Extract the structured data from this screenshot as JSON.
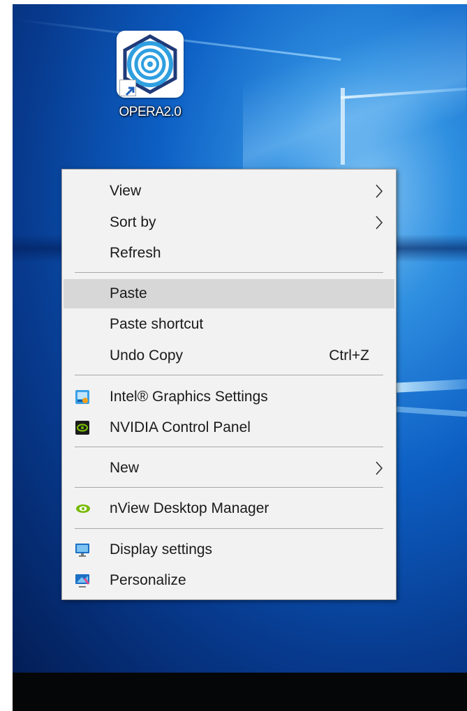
{
  "desktop": {
    "shortcut": {
      "label": "OPERA2.0",
      "icon": "opera-spiral-icon"
    }
  },
  "menu": {
    "items": [
      {
        "label": "View",
        "submenu": true
      },
      {
        "label": "Sort by",
        "submenu": true
      },
      {
        "label": "Refresh"
      },
      {
        "label": "Paste",
        "highlighted": true
      },
      {
        "label": "Paste shortcut"
      },
      {
        "label": "Undo Copy",
        "shortcut": "Ctrl+Z"
      },
      {
        "label": "Intel® Graphics Settings",
        "icon": "intel-graphics-icon"
      },
      {
        "label": "NVIDIA Control Panel",
        "icon": "nvidia-control-panel-icon"
      },
      {
        "label": "New",
        "submenu": true
      },
      {
        "label": "nView Desktop Manager",
        "icon": "nvidia-eye-icon"
      },
      {
        "label": "Display settings",
        "icon": "display-settings-icon"
      },
      {
        "label": "Personalize",
        "icon": "personalize-icon"
      }
    ]
  },
  "colors": {
    "highlight": "#d7d7d7",
    "menu_bg": "#f2f2f2",
    "taskbar": "#050608"
  }
}
